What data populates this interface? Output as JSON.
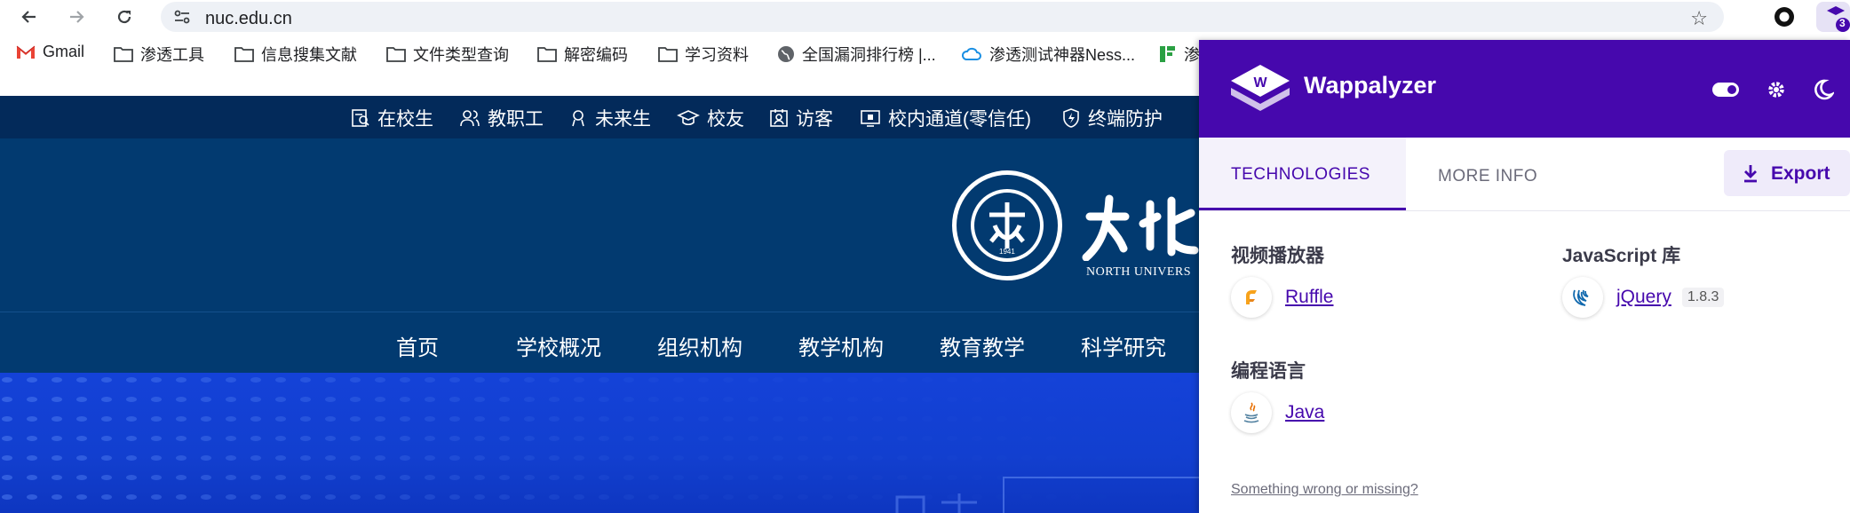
{
  "browser": {
    "url": "nuc.edu.cn",
    "ext2_badge": "3"
  },
  "bookmarks": [
    {
      "label": "Gmail",
      "icon": "gmail-icon"
    },
    {
      "label": "渗透工具",
      "icon": "folder-icon"
    },
    {
      "label": "信息搜集文献",
      "icon": "folder-icon"
    },
    {
      "label": "文件类型查询",
      "icon": "folder-icon"
    },
    {
      "label": "解密编码",
      "icon": "folder-icon"
    },
    {
      "label": "学习资料",
      "icon": "folder-icon"
    },
    {
      "label": "全国漏洞排行榜 |...",
      "icon": "globe-icon"
    },
    {
      "label": "渗透测试神器Ness...",
      "icon": "cloud-icon"
    },
    {
      "label": "渗",
      "icon": "green-bars-icon"
    }
  ],
  "site": {
    "top_links": [
      "在校生",
      "教职工",
      "未来生",
      "校友",
      "访客",
      "校内通道(零信任)",
      "终端防护"
    ],
    "logo_text": "NORTH UNIVERS",
    "seal_year": "1941",
    "nav": [
      "首页",
      "学校概况",
      "组织机构",
      "教学机构",
      "教育教学",
      "科学研究"
    ]
  },
  "wappalyzer": {
    "title": "Wappalyzer",
    "logo_letter": "W",
    "tabs": {
      "technologies": "TECHNOLOGIES",
      "more_info": "MORE INFO"
    },
    "export_label": "Export",
    "categories": [
      {
        "name": "视频播放器",
        "techs": [
          {
            "name": "Ruffle",
            "version": "",
            "icon": "ruffle-icon"
          }
        ]
      },
      {
        "name": "JavaScript 库",
        "techs": [
          {
            "name": "jQuery",
            "version": "1.8.3",
            "icon": "jquery-icon"
          }
        ]
      },
      {
        "name": "编程语言",
        "techs": [
          {
            "name": "Java",
            "version": "",
            "icon": "java-icon"
          }
        ]
      }
    ],
    "footer_link": "Something wrong or missing?"
  },
  "colors": {
    "wappalyzer_purple": "#4608ad",
    "site_dark_blue": "#023a70",
    "site_top_bar": "#032a5a",
    "hero_blue": "#1442d8"
  }
}
